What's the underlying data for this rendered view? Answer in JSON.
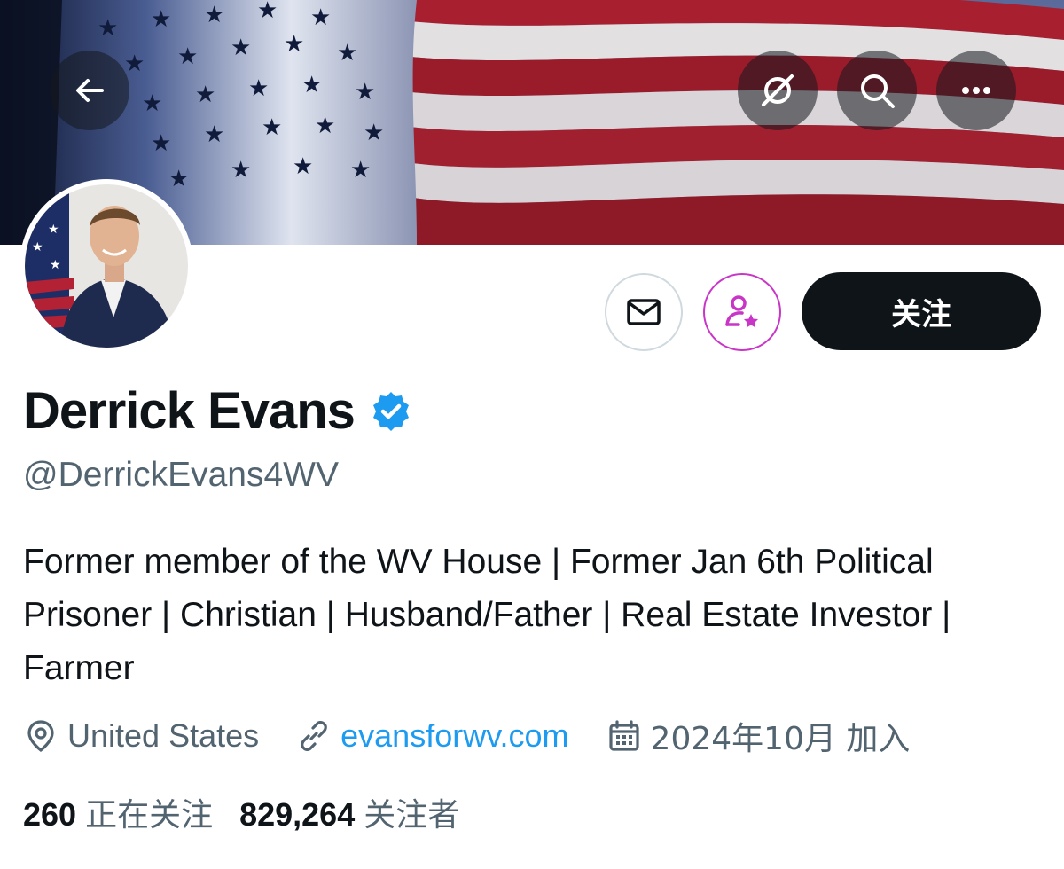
{
  "header": {
    "back_icon": "arrow-left-icon",
    "grok_icon": "grok-icon",
    "search_icon": "search-icon",
    "more_icon": "more-icon"
  },
  "profile": {
    "name": "Derrick Evans",
    "verified_icon": "verified-badge-icon",
    "handle": "@DerrickEvans4WV",
    "bio": "Former member of the WV House | Former Jan 6th Political Prisoner | Christian | Husband/Father | Real Estate Investor | Farmer",
    "location": "United States",
    "website": "evansforwv.com",
    "joined": "2024年10月 加入"
  },
  "actions": {
    "message_icon": "mail-icon",
    "subscribe_icon": "subscribe-user-star-icon",
    "follow_label": "关注"
  },
  "stats": {
    "following_count": "260",
    "following_label": "正在关注",
    "followers_count": "829,264",
    "followers_label": "关注者"
  },
  "colors": {
    "accent": "#1d9bf0",
    "text_primary": "#0f1419",
    "text_secondary": "#536471",
    "subscribe_accent": "#c936c7"
  }
}
